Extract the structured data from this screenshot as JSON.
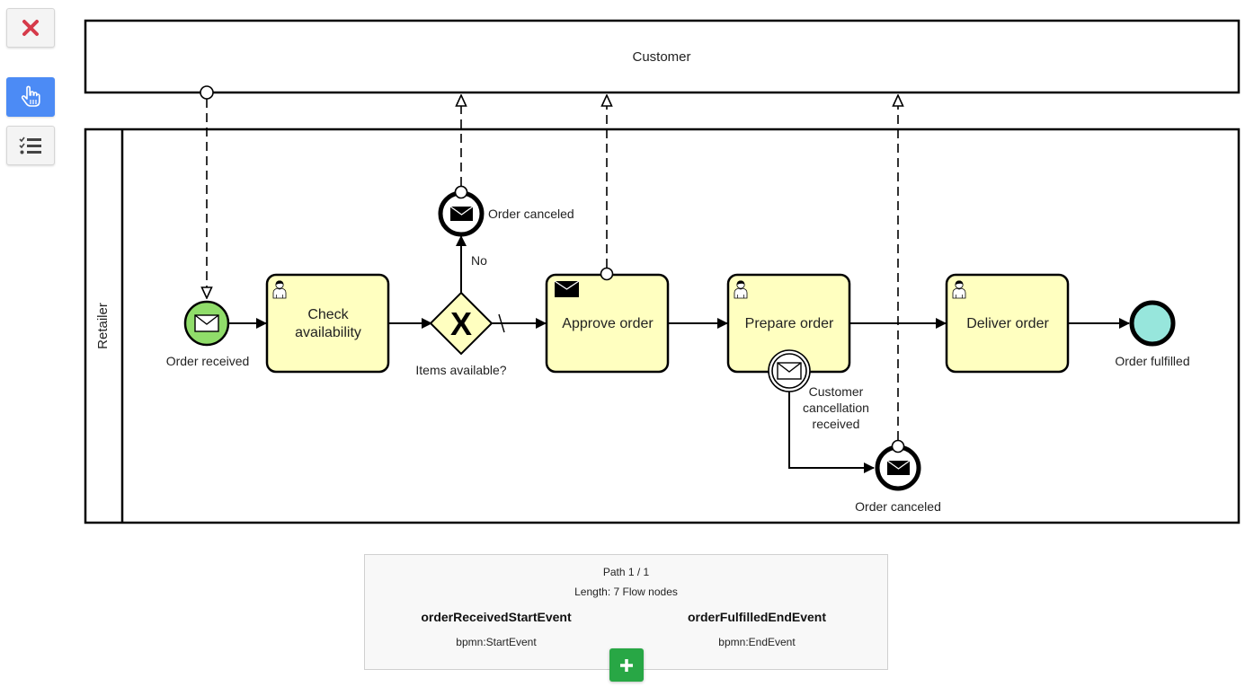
{
  "toolbar": {
    "close_icon": "close-x-icon",
    "hand_icon": "hand-pointer-icon",
    "list_icon": "checklist-icon",
    "close_color": "#d63a4a",
    "active_color": "#4c8bf5"
  },
  "diagram": {
    "pools": {
      "customer": "Customer",
      "retailer": "Retailer"
    },
    "events": {
      "order_received": "Order received",
      "order_canceled_top": "Order canceled",
      "order_canceled_bottom": "Order canceled",
      "order_fulfilled": "Order fulfilled",
      "customer_cancellation": [
        "Customer",
        "cancellation",
        "received"
      ]
    },
    "gateway": {
      "label": "Items available?",
      "marker": "X",
      "no_flow_label": "No"
    },
    "tasks": {
      "check_availability": [
        "Check",
        "availability"
      ],
      "approve_order": "Approve order",
      "prepare_order": "Prepare order",
      "deliver_order": "Deliver order"
    },
    "colors": {
      "task_fill": "#ffffc0",
      "start_fill": "#90dd6a",
      "end_fill": "#97e6dc",
      "stroke": "#000000"
    }
  },
  "path_panel": {
    "path": "Path 1 / 1",
    "length": "Length: 7 Flow nodes",
    "start": {
      "id": "orderReceivedStartEvent",
      "type": "bpmn:StartEvent"
    },
    "end": {
      "id": "orderFulfilledEndEvent",
      "type": "bpmn:EndEvent"
    },
    "add_button_icon": "plus-icon"
  }
}
